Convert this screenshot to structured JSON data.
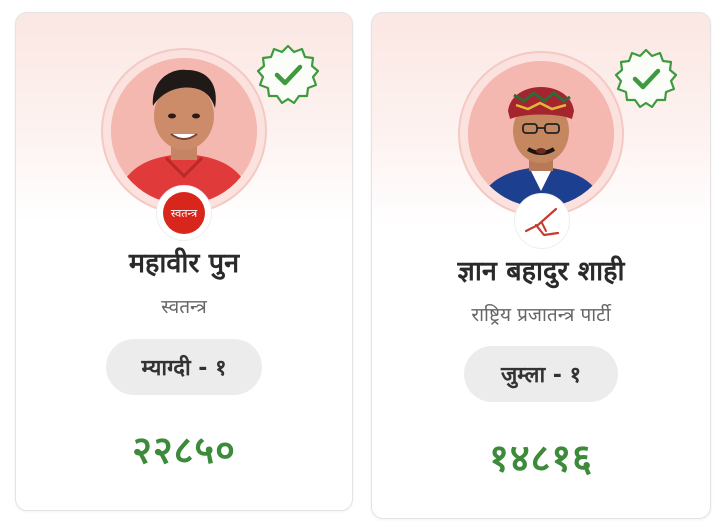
{
  "candidates": [
    {
      "name": "महावीर पुन",
      "party": "स्वतन्त्र",
      "symbol_text": "स्वतन्त्र",
      "constituency": "म्याग्दी - १",
      "votes": "२२८५०",
      "status": "winner"
    },
    {
      "name": "ज्ञान बहादुर शाही",
      "party": "राष्ट्रिय प्रजातन्त्र पार्टी",
      "constituency": "जुम्ला - १",
      "votes": "१४८१६",
      "status": "winner"
    }
  ],
  "colors": {
    "verify_green": "#3f9a3f",
    "votes_green": "#3c8a3a",
    "independent_red": "#d9261c"
  },
  "icons": {
    "verified": "verified-badge-icon",
    "party_symbol_2": "plough-icon"
  }
}
